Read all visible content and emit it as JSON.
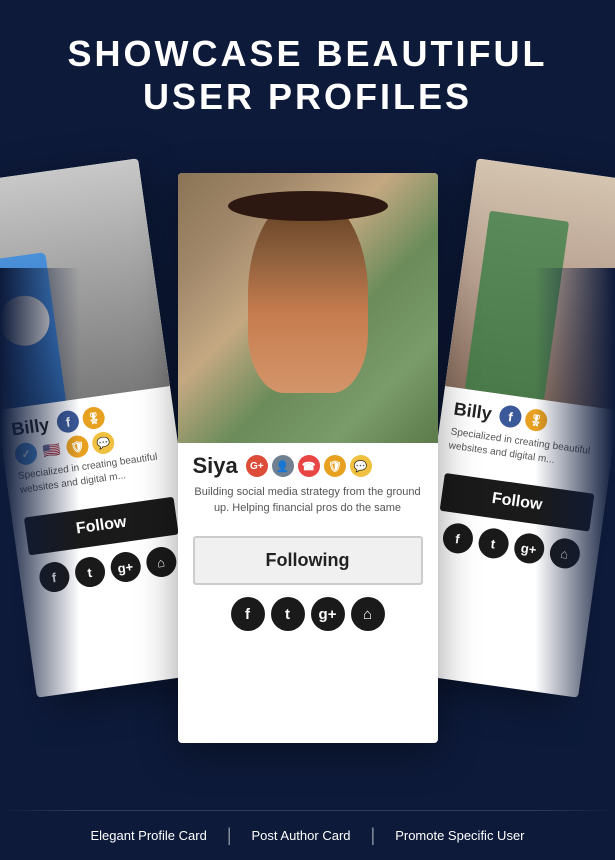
{
  "header": {
    "title_line1": "SHOWCASE BEAUTIFUL",
    "title_line2": "USER PROFILES"
  },
  "cards": {
    "left": {
      "name": "Billy",
      "bio": "Specialized in creating beautiful websites and digital m...",
      "follow_label": "Follow",
      "badges": [
        "check-icon",
        "flag-icon",
        "shield-icon",
        "chat-icon"
      ],
      "social": [
        "facebook-icon",
        "twitter-icon",
        "google-plus-icon",
        "home-icon"
      ]
    },
    "center": {
      "name": "Siya",
      "bio": "Building social media strategy from the ground up. Helping financial pros do the same",
      "follow_label": "Following",
      "badges": [
        "google-icon",
        "person-icon",
        "support-icon",
        "shield-icon",
        "chat-icon"
      ],
      "social": [
        "facebook-icon",
        "twitter-icon",
        "google-plus-icon",
        "home-icon"
      ]
    },
    "right": {
      "name": "Billy",
      "bio": "Specialized in creating beautiful websites and digital m...",
      "follow_label": "Follow",
      "badges": [
        "facebook-icon",
        "ribbon-icon"
      ],
      "social": [
        "facebook-icon",
        "twitter-icon",
        "google-plus-icon",
        "home-icon"
      ]
    }
  },
  "footer": {
    "items": [
      "Elegant Profile Card",
      "Post Author Card",
      "Promote Specific User"
    ],
    "divider": "|"
  }
}
